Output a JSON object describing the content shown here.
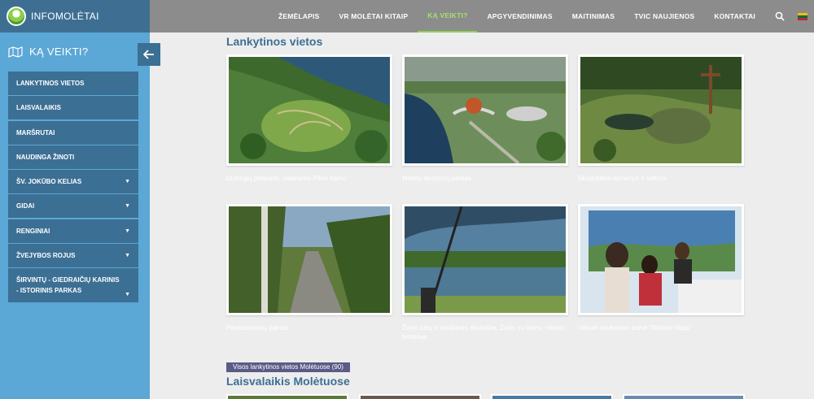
{
  "brand": {
    "name": "INFOMOLĖTAI"
  },
  "nav": {
    "items": [
      {
        "label": "ŽEMĖLAPIS"
      },
      {
        "label": "VR MOLĖTAI KITAIP"
      },
      {
        "label": "KĄ VEIKTI?",
        "active": true
      },
      {
        "label": "APGYVENDINIMAS"
      },
      {
        "label": "MAITINIMAS"
      },
      {
        "label": "TVIC NAUJIENOS"
      },
      {
        "label": "KONTAKTAI"
      }
    ],
    "icons": [
      "search-icon",
      "lithuanian-flag-icon"
    ]
  },
  "sidebar": {
    "title": "KĄ VEIKTI?",
    "items": [
      {
        "label": "LANKYTINOS VIETOS"
      },
      {
        "label": "LAISVALAIKIS"
      },
      {
        "label": "MARŠRUTAI"
      },
      {
        "label": "NAUDINGA ŽINOTI"
      },
      {
        "label": "ŠV. JOKŪBO KELIAS",
        "caret": "▼"
      },
      {
        "label": "GIDAI",
        "caret": "▼"
      },
      {
        "label": "RENGINIAI",
        "caret": "▼"
      },
      {
        "label": "ŽVEJYBOS ROJUS",
        "caret": "▼"
      },
      {
        "label": "ŠIRVINTŲ - GIEDRAIČIŲ KARINIS - ISTORINIS PARKAS",
        "caret": "▼"
      }
    ]
  },
  "main": {
    "section1_title": "Lankytinos vietos",
    "cards": [
      {
        "caption": "Dubingių piliavietė, vadinama Pilies kalnu"
      },
      {
        "caption": "Molėtų skulptūrų parkas"
      },
      {
        "caption": "Skudutiškio akmenys ir šaltinis"
      },
      {
        "caption": "Pavasarininkų kalnas"
      },
      {
        "caption": "Žvejo batų ir meškerės skulptūra, Žuvis su balnu, miesto fontanas"
      },
      {
        "caption": "Virtuali edukacinė erdvė \"Molėtai kitaip\""
      }
    ],
    "all_button": "Visos lankytinos vietos Molėtuose (90)",
    "section2_title": "Laisvalaikis Molėtuose"
  },
  "colors": {
    "topbar": "#8c8c8c",
    "brand_bg": "#3e6f92",
    "sidebar_bg": "#5ba7d6",
    "menu_bg": "#3c6f94",
    "active_nav": "#a5e06d",
    "title": "#3c6f94",
    "button_bg": "#5b5b88"
  }
}
